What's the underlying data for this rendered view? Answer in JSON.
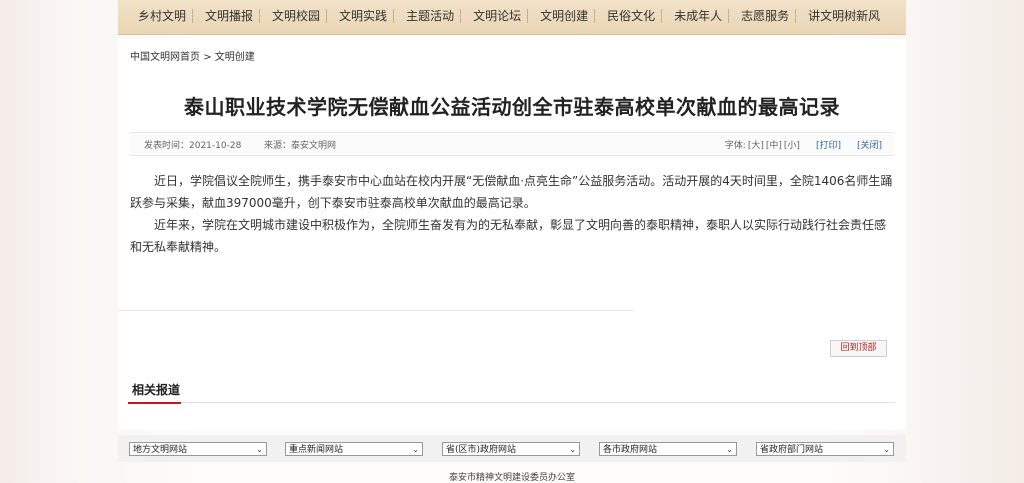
{
  "nav": {
    "items": [
      "乡村文明",
      "文明播报",
      "文明校园",
      "文明实践",
      "主题活动",
      "文明论坛",
      "文明创建",
      "民俗文化",
      "未成年人",
      "志愿服务",
      "讲文明树新风"
    ]
  },
  "breadcrumb": {
    "home": "中国文明网首页",
    "sep": ">",
    "section": "文明创建"
  },
  "article": {
    "title": "泰山职业技术学院无偿献血公益活动创全市驻泰高校单次献血的最高记录",
    "date": "发表时间：2021-10-28",
    "source": "来源：泰安文明网",
    "font_label": "字体:",
    "font_large": "[大]",
    "font_mid": "[中]",
    "font_small": "[小]",
    "print": "[打印]",
    "close": "[关闭]",
    "paragraphs": [
      "近日，学院倡议全院师生，携手泰安市中心血站在校内开展“无偿献血·点亮生命”公益服务活动。活动开展的4天时间里，全院1406名师生踊跃参与采集，献血397000毫升，创下泰安市驻泰高校单次献血的最高记录。",
      "近年来，学院在文明城市建设中积极作为，全院师生奋发有为的无私奉献，彰显了文明向善的泰职精神，泰职人以实际行动践行社会责任感和无私奉献精神。"
    ],
    "back_to_top": "回到顶部"
  },
  "related": {
    "title": "相关报道"
  },
  "selects": [
    "地方文明网站",
    "重点新闻网站",
    "省(区市)政府网站",
    "各市政府网站",
    "省政府部门网站"
  ],
  "footer": {
    "text": "泰安市精神文明建设委员办公室"
  }
}
